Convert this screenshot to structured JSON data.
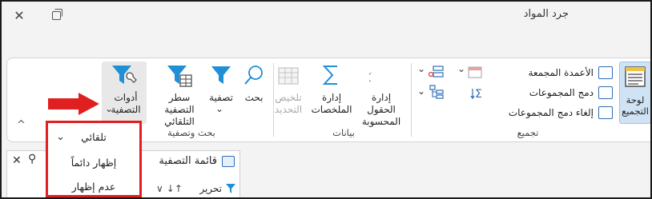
{
  "window": {
    "title": "جرد المواد",
    "close_glyph": "✕",
    "restore_glyph": ""
  },
  "ribbon": {
    "groups": {
      "outline": "تجميع",
      "data": "بيانات",
      "sort_filter": "بحث وتصفية"
    },
    "outline": {
      "dashboard_label": "لوحة التجميع",
      "grouped_columns": "الأعمدة المجمعة",
      "merge_groups": "دمج المجموعات",
      "unmerge_groups": "إلغاء دمج المجموعات"
    },
    "data": {
      "calc_fields": "إدارة الحقول المحسوبة",
      "summaries": "إدارة الملخصات",
      "refresh_summary": "تلخيص التحديد"
    },
    "sort_filter": {
      "search": "بحث",
      "filter": "تصفية",
      "auto_filter_row": "سطر التصفية التلقائي",
      "filter_tools": "أدوات التصفية"
    },
    "collapse_glyph": "^",
    "chevron_glyph": "⌄"
  },
  "dropdown": {
    "items": [
      "تلقائي",
      "إظهار دائماً",
      "عدم إظهار"
    ],
    "check_glyph": "✓"
  },
  "pane": {
    "filter_list": "قائمة التصفية",
    "edit": "تحرير",
    "close_glyph": "✕",
    "pin_glyph": "⚲"
  },
  "colors": {
    "accent": "#2f6db5",
    "highlight": "#e02020",
    "icon_blue": "#1f8fd6"
  }
}
